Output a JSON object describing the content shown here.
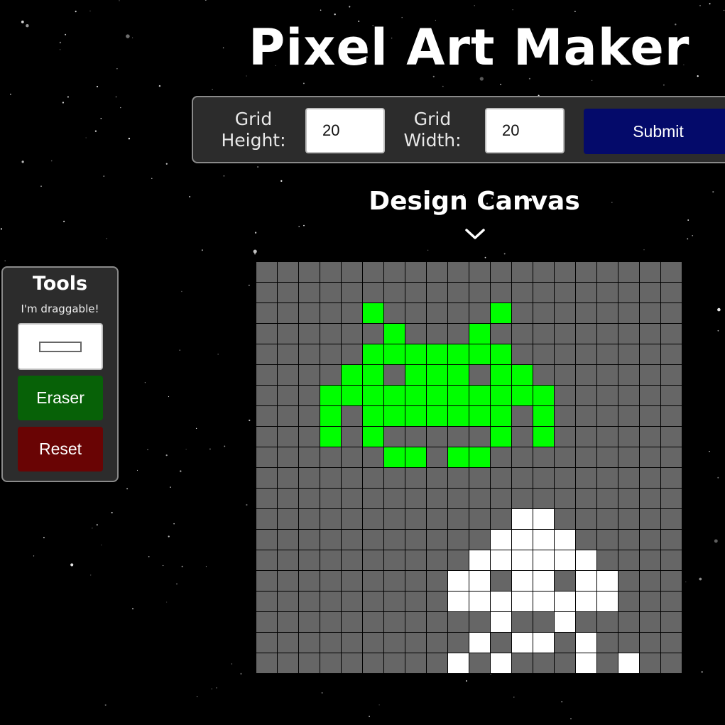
{
  "header": {
    "title": "Pixel Art Maker"
  },
  "size_form": {
    "height_label": "Grid Height:",
    "height_value": "20",
    "width_label": "Grid Width:",
    "width_value": "20",
    "submit_label": "Submit"
  },
  "canvas": {
    "title": "Design Canvas",
    "rows": 20,
    "cols": 20,
    "default_color": "#666666",
    "palette": {
      "G": "#00ff00",
      "W": "#ffffff"
    },
    "pixels": [
      "....................",
      "....................",
      ".....G.....G........",
      "......G...G.........",
      ".....GGGGGGG........",
      "....GG.GGG.GG.......",
      "...GGGGGGGGGGG......",
      "...G.GGGGGGG.G......",
      "...G.G.....G.G......",
      "......GG.GG.........",
      "....................",
      "....................",
      "............WW......",
      "...........WWWW.....",
      "..........WWWWWW....",
      ".........WW.WW.WW...",
      ".........WWWWWWWW...",
      "...........W..W.....",
      "..........W.WW.W....",
      ".........W.W...W.W.."
    ]
  },
  "tools": {
    "title": "Tools",
    "subtitle": "I'm draggable!",
    "selected_color": "#ffffff",
    "eraser_label": "Eraser",
    "reset_label": "Reset"
  },
  "colors": {
    "background": "#000000",
    "panel": "#2c2c2c",
    "submit": "#040a6a",
    "eraser": "#076107",
    "reset": "#690404"
  }
}
